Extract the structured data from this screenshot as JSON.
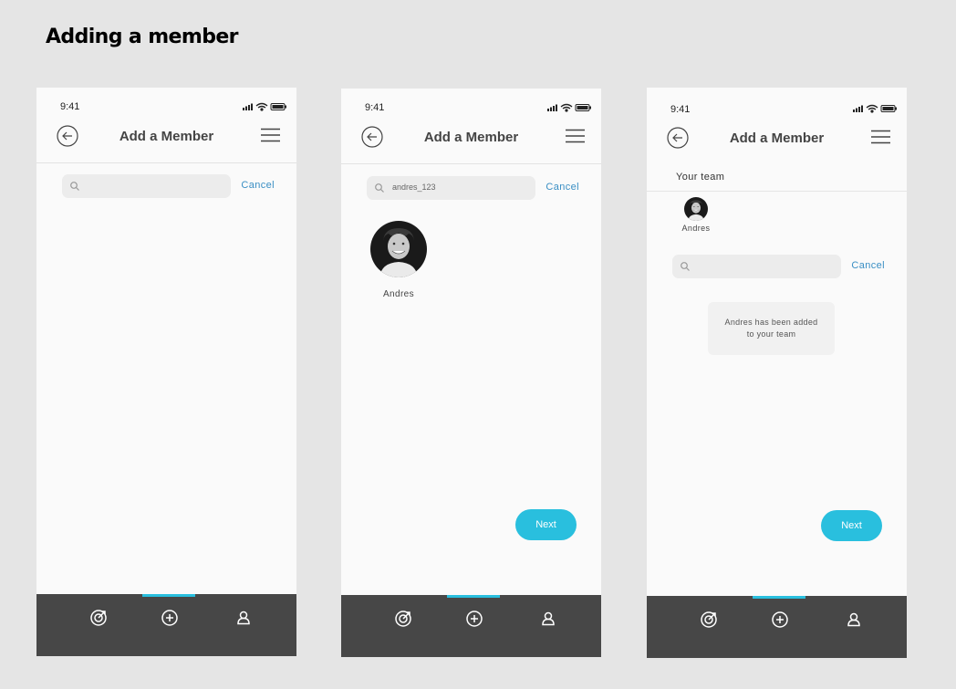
{
  "page": {
    "title": "Adding a member"
  },
  "screens": [
    {
      "status": {
        "time": "9:41"
      },
      "header": {
        "title": "Add a Member"
      },
      "search": {
        "value": "",
        "cancel_label": "Cancel"
      }
    },
    {
      "status": {
        "time": "9:41"
      },
      "header": {
        "title": "Add a Member"
      },
      "search": {
        "value": "andres_123",
        "cancel_label": "Cancel"
      },
      "result": {
        "name": "Andres"
      },
      "next_label": "Next"
    },
    {
      "status": {
        "time": "9:41"
      },
      "header": {
        "title": "Add a Member"
      },
      "team": {
        "label": "Your team",
        "members": [
          {
            "name": "Andres"
          }
        ]
      },
      "search": {
        "value": "",
        "cancel_label": "Cancel"
      },
      "toast": {
        "line1": "Andres has been added",
        "line2": "to your team"
      },
      "next_label": "Next"
    }
  ],
  "tabbar": {
    "icons": [
      "target-icon",
      "add-circle-icon",
      "profile-icon"
    ],
    "active_index": 1
  },
  "colors": {
    "accent": "#29bfde",
    "link": "#3a8fc4",
    "tabbar": "#474747",
    "background": "#e5e5e5"
  }
}
